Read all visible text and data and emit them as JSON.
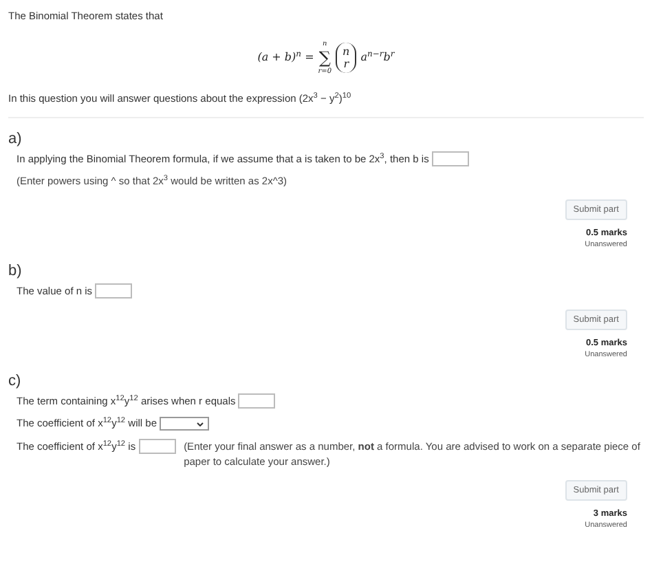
{
  "intro": "The Binomial Theorem states that",
  "formula": {
    "lhs": "(a + b)$^{n}$ =",
    "sigma": "∑",
    "sum_upper": "n",
    "sum_lower": "r=0",
    "binom_top": "n",
    "binom_bottom": "r",
    "term": "a$^{n−r}$b$^{r}$"
  },
  "question": "In this question you will answer questions about the expression (2x$^{3}$ − y$^{2}$)$^{10}$",
  "parts": [
    {
      "label": "a)",
      "lines": [
        {
          "kind": "input",
          "text": "In applying the Binomial Theorem formula, if we assume that a is taken to be 2x$^{3}$, then b is"
        },
        {
          "kind": "note",
          "text": "(Enter powers using ^ so that 2x$^{3}$ would be written as 2x^3)"
        }
      ],
      "button": "Submit part",
      "marks": "0.5 marks",
      "status": "Unanswered"
    },
    {
      "label": "b)",
      "lines": [
        {
          "kind": "input",
          "text": "The value of n is"
        }
      ],
      "button": "Submit part",
      "marks": "0.5 marks",
      "status": "Unanswered"
    },
    {
      "label": "c)",
      "lines": [
        {
          "kind": "input",
          "text": "The term containing x$^{12}$y$^{12}$ arises when r equals"
        },
        {
          "kind": "select",
          "text": "The coefficient of x$^{12}$y$^{12}$ will be"
        },
        {
          "kind": "input_note",
          "text": "The coefficient of x$^{12}$y$^{12}$ is",
          "note": "(Enter your final answer as a number, **not** a formula. You are advised to work on a separate piece of paper to calculate your answer.)"
        }
      ],
      "button": "Submit part",
      "marks": "3 marks",
      "status": "Unanswered"
    }
  ]
}
